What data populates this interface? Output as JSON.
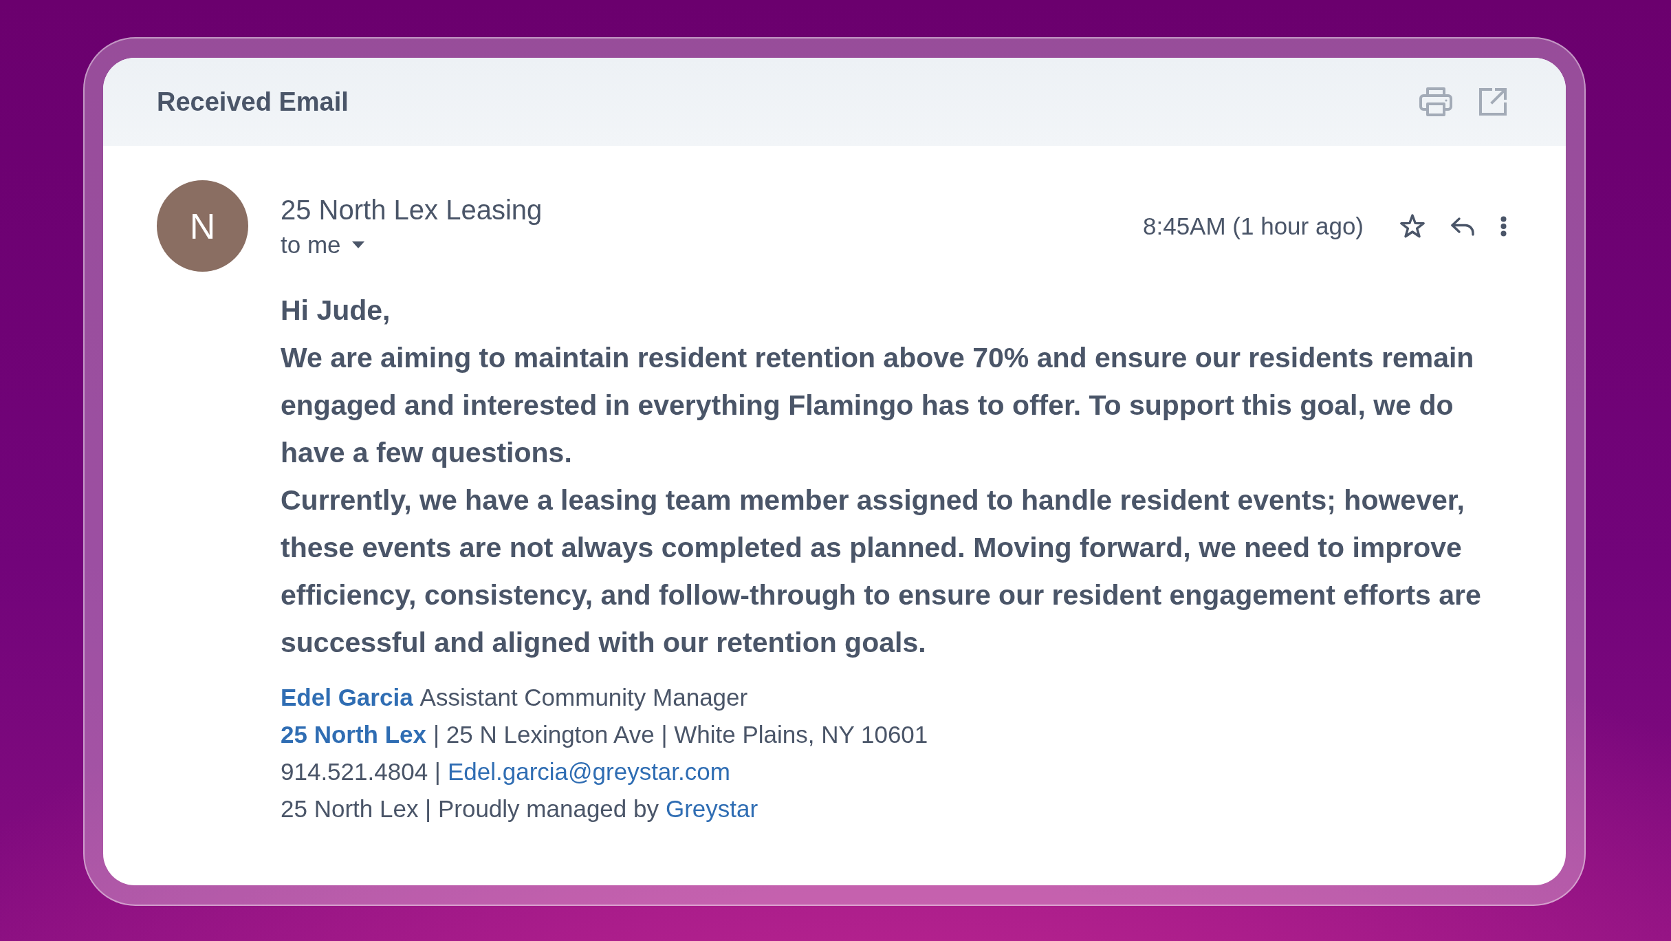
{
  "window": {
    "title": "Received Email"
  },
  "email": {
    "sender": {
      "initial": "N",
      "name": "25 North Lex Leasing",
      "recipient": "to me"
    },
    "time": "8:45AM (1 hour ago)",
    "starred": false,
    "greeting": "Hi Jude,",
    "paragraphs": [
      "We are aiming to maintain resident retention above 70% and ensure our residents remain engaged and interested in everything Flamingo has to offer. To support this goal, we do have a few questions.",
      "Currently, we have a leasing team member assigned to handle resident events; however, these events are not always completed as planned. Moving forward, we need to improve efficiency, consistency, and follow-through to ensure our resident engagement efforts are successful and aligned with our retention goals."
    ],
    "signature": [
      {
        "segments": [
          {
            "kind": "strong-link",
            "text": "Edel Garcia"
          },
          {
            "kind": "text",
            "text": "Assistant Community Manager"
          }
        ]
      },
      {
        "segments": [
          {
            "kind": "strong-link",
            "text": "25 North Lex"
          },
          {
            "kind": "text",
            "text": "| 25 N Lexington Ave | White Plains, NY 10601"
          }
        ]
      },
      {
        "segments": [
          {
            "kind": "text",
            "text": "914.521.4804 |"
          },
          {
            "kind": "link",
            "text": "Edel.garcia@greystar.com"
          }
        ]
      },
      {
        "segments": [
          {
            "kind": "text",
            "text": "25 North Lex | Proudly managed by"
          },
          {
            "kind": "link",
            "text": "Greystar"
          }
        ]
      }
    ]
  }
}
